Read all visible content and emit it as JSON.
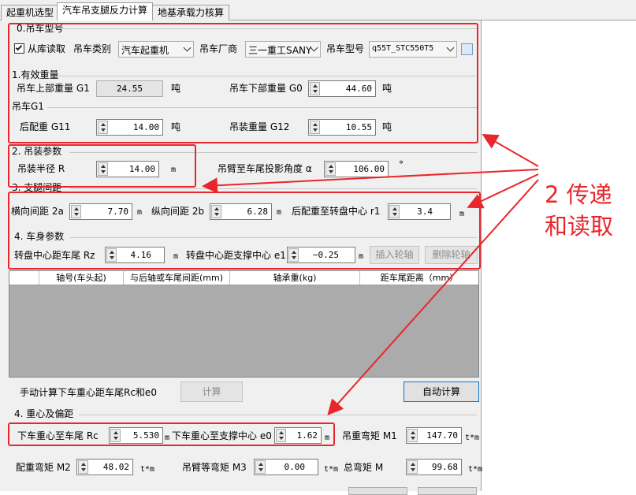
{
  "tabs": [
    "起重机选型",
    "汽车吊支腿反力计算",
    "地基承载力核算"
  ],
  "active_tab": 1,
  "sections": {
    "crane_model": "0.吊车型号",
    "effective_weight": "1.有效重量",
    "lift_params": "2. 吊装参数",
    "outrigger_spacing": "3. 支腿间距",
    "body_params": "4. 车身参数",
    "cog": "4. 重心及偏距"
  },
  "crane": {
    "from_library_label": "从库读取",
    "from_library_checked": true,
    "category_label": "吊车类别",
    "category_value": "汽车起重机",
    "maker_label": "吊车厂商",
    "maker_value": "三一重工SANY",
    "model_label": "吊车型号",
    "model_value": "q55T_STC550T5"
  },
  "weight": {
    "g1_label": "吊车上部重量 G1",
    "g1_value": "24.55",
    "g1_unit": "吨",
    "g0_label": "吊车下部重量 G0",
    "g0_value": "44.60",
    "g0_unit": "吨",
    "sub_label": "吊车G1",
    "g11_label": "后配重 G11",
    "g11_value": "14.00",
    "g11_unit": "吨",
    "g12_label": "吊装重量 G12",
    "g12_value": "10.55",
    "g12_unit": "吨"
  },
  "lift": {
    "radius_label": "吊装半径 R",
    "radius_value": "14.00",
    "radius_unit": "m",
    "angle_label": "吊臂至车尾投影角度 α",
    "angle_value": "106.00",
    "angle_unit": "°"
  },
  "spacing": {
    "a_label": "横向间距 2a",
    "a_value": "7.70",
    "a_unit": "m",
    "b_label": "纵向间距 2b",
    "b_value": "6.28",
    "b_unit": "m",
    "r1_label": "后配重至转盘中心 r1",
    "r1_value": "3.4",
    "r1_unit": "m"
  },
  "body": {
    "rz_label": "转盘中心距车尾 Rz",
    "rz_value": "4.16",
    "rz_unit": "m",
    "e1_label": "转盘中心距支撑中心 e1",
    "e1_value": "−0.25",
    "e1_unit": "m",
    "insert_axle": "插入轮轴",
    "delete_axle": "删除轮轴"
  },
  "axle_table": {
    "columns": [
      "轴号(车头起)",
      "与后轴或车尾间距(mm)",
      "轴承重(kg)",
      "距车尾距离（mm）"
    ]
  },
  "manual": {
    "label": "手动计算下车重心距车尾Rc和e0",
    "calc_button": "计算",
    "auto_button": "自动计算"
  },
  "cog": {
    "rc_label": "下车重心至车尾 Rc",
    "rc_value": "5.530",
    "rc_unit": "m",
    "e0_label": "下车重心至支撑中心 e0",
    "e0_value": "1.62",
    "e0_unit": "m",
    "m1_label": "吊重弯矩 M1",
    "m1_value": "147.70",
    "m1_unit": "t*m",
    "m2_label": "配重弯矩 M2",
    "m2_value": "48.02",
    "m2_unit": "t*m",
    "m3_label": "吊臂等弯矩 M3",
    "m3_value": "0.00",
    "m3_unit": "t*m",
    "m_label": "总弯矩 M",
    "m_value": "99.68",
    "m_unit": "t*m"
  },
  "annotation": {
    "line1": "2 传递",
    "line2": "和读取",
    "color": "#e8262b"
  }
}
